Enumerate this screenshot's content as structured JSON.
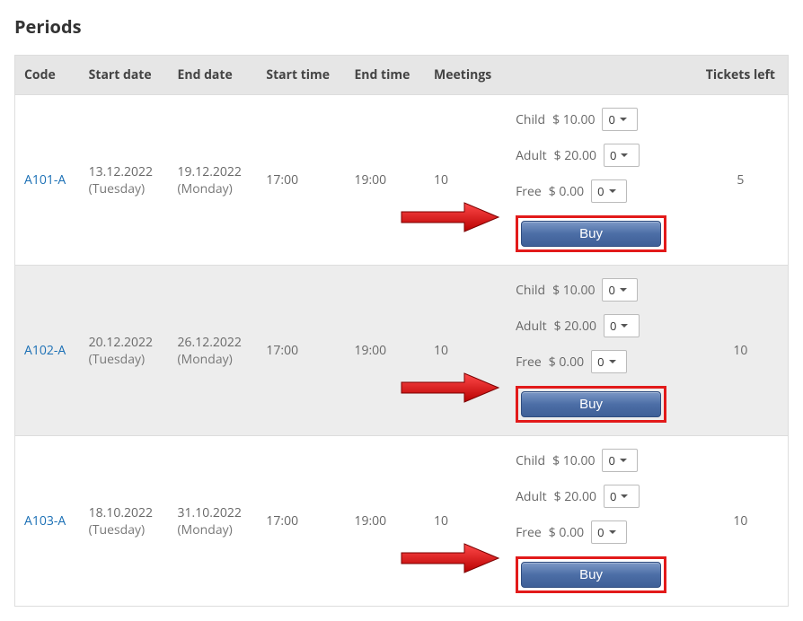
{
  "title": "Periods",
  "columns": {
    "code": "Code",
    "start_date": "Start date",
    "end_date": "End date",
    "start_time": "Start time",
    "end_time": "End time",
    "meetings": "Meetings",
    "tickets_left": "Tickets left"
  },
  "buy_label": "Buy",
  "qty_default": "0",
  "rows": [
    {
      "code": "A101-A",
      "start_date": "13.12.2022",
      "start_day": "(Tuesday)",
      "end_date": "19.12.2022",
      "end_day": "(Monday)",
      "start_time": "17:00",
      "end_time": "19:00",
      "meetings": "10",
      "tickets_left": "5",
      "prices": [
        {
          "label": "Child",
          "amount": "$ 10.00"
        },
        {
          "label": "Adult",
          "amount": "$ 20.00"
        },
        {
          "label": "Free",
          "amount": "$ 0.00"
        }
      ]
    },
    {
      "code": "A102-A",
      "start_date": "20.12.2022",
      "start_day": "(Tuesday)",
      "end_date": "26.12.2022",
      "end_day": "(Monday)",
      "start_time": "17:00",
      "end_time": "19:00",
      "meetings": "10",
      "tickets_left": "10",
      "prices": [
        {
          "label": "Child",
          "amount": "$ 10.00"
        },
        {
          "label": "Adult",
          "amount": "$ 20.00"
        },
        {
          "label": "Free",
          "amount": "$ 0.00"
        }
      ]
    },
    {
      "code": "A103-A",
      "start_date": "18.10.2022",
      "start_day": "(Tuesday)",
      "end_date": "31.10.2022",
      "end_day": "(Monday)",
      "start_time": "17:00",
      "end_time": "19:00",
      "meetings": "10",
      "tickets_left": "10",
      "prices": [
        {
          "label": "Child",
          "amount": "$ 10.00"
        },
        {
          "label": "Adult",
          "amount": "$ 20.00"
        },
        {
          "label": "Free",
          "amount": "$ 0.00"
        }
      ]
    }
  ]
}
